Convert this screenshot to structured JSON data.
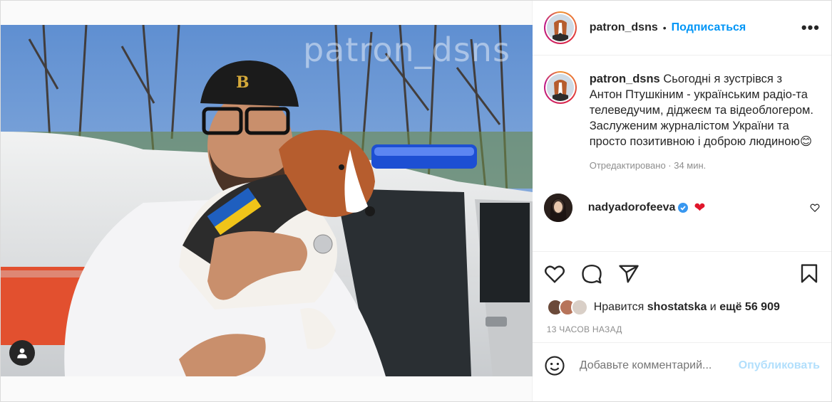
{
  "post": {
    "watermark": "patron_dsns",
    "author": "patron_dsns",
    "separator": "•",
    "follow_label": "Подписаться",
    "more_label": "•••",
    "caption_user": "patron_dsns",
    "caption_text": "Сьогодні я зустрівся з Антон Птушкіним - українським радіо-та телеведучим, діджеєм та відеоблогером. Заслуженим журналістом України та просто позитивною і доброю людиною😊",
    "caption_meta": "Отредактировано · 34 мин.",
    "comment": {
      "user": "nadyadorofeeva",
      "text": "❤"
    },
    "likes_prefix": "Нравится ",
    "likes_user": "shostatska",
    "likes_mid": " и ",
    "likes_count": "ещё 56 909",
    "time_ago": "13 ЧАСОВ НАЗАД",
    "comment_placeholder": "Добавьте комментарий...",
    "publish_label": "Опубликовать"
  },
  "icons": [
    "user-tag-icon",
    "heart-icon",
    "comment-icon",
    "share-icon",
    "bookmark-icon",
    "smile-icon",
    "verified-icon",
    "small-heart-icon"
  ],
  "colors": {
    "link": "#0095f6",
    "publish_disabled": "#b2dffc",
    "muted": "#8e8e8e",
    "text": "#262626"
  }
}
